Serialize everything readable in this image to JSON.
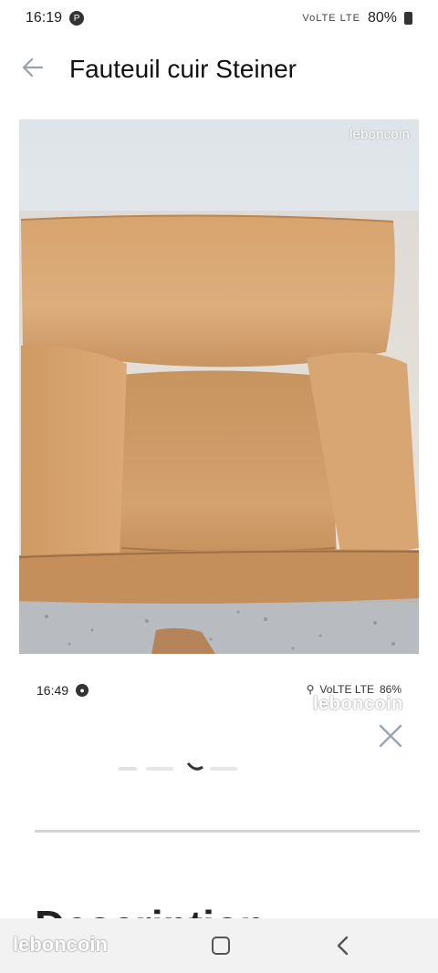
{
  "status_bar": {
    "time": "16:19",
    "notification_glyph": "P",
    "network": "VoLTE LTE",
    "battery": "80%"
  },
  "header": {
    "title": "Fauteuil cuir Steiner",
    "back_icon": "arrow-left-icon"
  },
  "photo": {
    "watermark": "leboncoin",
    "subject": "tan leather armchair"
  },
  "embedded_screenshot": {
    "time": "16:49",
    "network": "VoLTE LTE",
    "battery": "86%",
    "watermark": "leboncoin",
    "close_icon": "close-icon",
    "heading": "Description"
  },
  "nav_bar": {
    "watermark": "leboncoin",
    "home_icon": "home-square-icon",
    "back_icon": "chevron-left-icon"
  },
  "colors": {
    "leather": "#d4a06a",
    "wall": "#e6eaed",
    "close_x": "#9aa6b4"
  }
}
